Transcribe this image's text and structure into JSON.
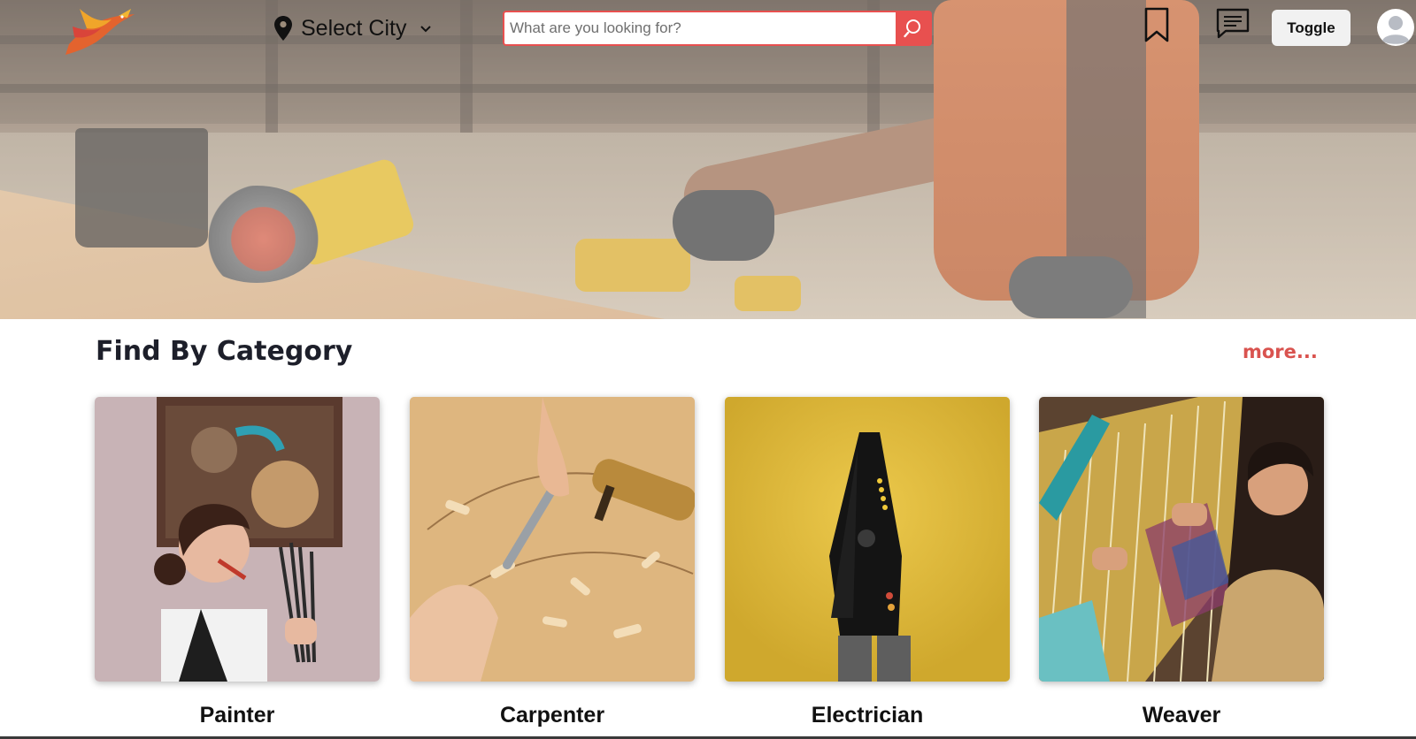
{
  "header": {
    "logo_icon": "phoenix-bird-logo",
    "city_selector": {
      "label": "Select City",
      "icon": "map-pin-icon",
      "dropdown_icon": "chevron-down-icon"
    },
    "search": {
      "placeholder": "What are you looking for?",
      "value": "",
      "button_icon": "search-icon"
    },
    "bookmark_icon": "bookmark-icon",
    "messages_icon": "chat-bubble-icon",
    "toggle_label": "Toggle",
    "avatar_icon": "user-avatar-icon"
  },
  "hero": {
    "image": "construction-worker-with-power-tools"
  },
  "categories_section": {
    "title": "Find By Category",
    "more_label": "more...",
    "items": [
      {
        "label": "Painter",
        "image": "woman-with-paint-brushes"
      },
      {
        "label": "Carpenter",
        "image": "wood-carving-chisel"
      },
      {
        "label": "Electrician",
        "image": "wire-stripper-on-yellow"
      },
      {
        "label": "Weaver",
        "image": "woman-at-loom"
      }
    ]
  },
  "colors": {
    "accent": "#e8504f",
    "more_link": "#d9534f",
    "title": "#1d1f2a"
  }
}
